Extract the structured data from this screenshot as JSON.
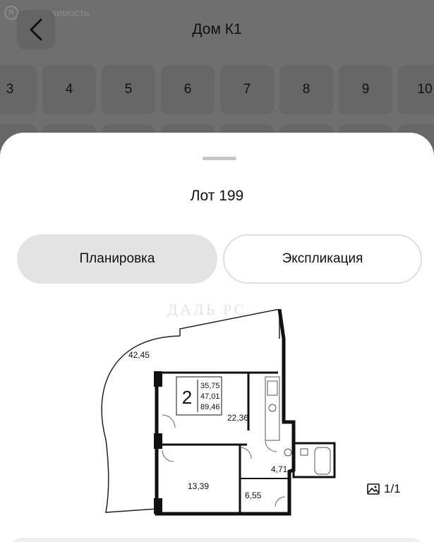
{
  "brand": {
    "logo": "Я",
    "name": "Недвижимость"
  },
  "header": {
    "title": "Дом К1",
    "back_icon": "chevron-left-icon"
  },
  "floors": [
    "3",
    "4",
    "5",
    "6",
    "7",
    "8",
    "9",
    "10"
  ],
  "sheet": {
    "lot_title": "Лот 199",
    "tabs": [
      {
        "label": "Планировка",
        "active": true
      },
      {
        "label": "Экспликация",
        "active": false
      }
    ],
    "watermark": "ДАЛЬ РС",
    "plan": {
      "rooms_count": "2",
      "areas": [
        "35,75",
        "47,01",
        "89,46"
      ],
      "labels": {
        "terrace": "42,45",
        "kitchen": "22,36",
        "bathroom": "4,71",
        "bedroom": "13,39",
        "hall": "6,55"
      }
    },
    "image_counter": "1/1"
  },
  "colors": {
    "overlay": "#6f6f6f",
    "sheet": "#ffffff",
    "active_tab": "#e3e3e3"
  }
}
